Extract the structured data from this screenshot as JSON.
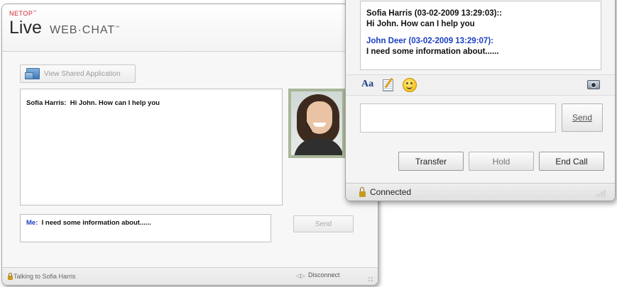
{
  "left_window": {
    "brand_small": "NETOP",
    "brand_small_tm": "™",
    "brand_live": "Live",
    "brand_web": "WEB·CHAT",
    "brand_web_tm": "™",
    "view_shared_label": "View Shared Application",
    "chat_log": {
      "sender": "Sofia Harris:",
      "message": "Hi John. How can I help you"
    },
    "input": {
      "sender": "Me:",
      "value": "I need some information about......"
    },
    "send_label": "Send",
    "status_text": "Talking to Sofia Harris",
    "disconnect_label": "Disconnect"
  },
  "right_window": {
    "log": [
      {
        "header": "Sofia Harris (03-02-2009 13:29:03)::",
        "message": "Hi John. How can I help you",
        "color": "#111111"
      },
      {
        "header": "John Deer (03-02-2009 13:29:07):",
        "message": "I need some information about......",
        "color": "#1a3fc2"
      }
    ],
    "toolbar": {
      "font_icon_label": "Aa"
    },
    "send_label": "Send",
    "buttons": {
      "transfer": "Transfer",
      "hold": "Hold",
      "end_call": "End Call"
    },
    "status_text": "Connected"
  }
}
